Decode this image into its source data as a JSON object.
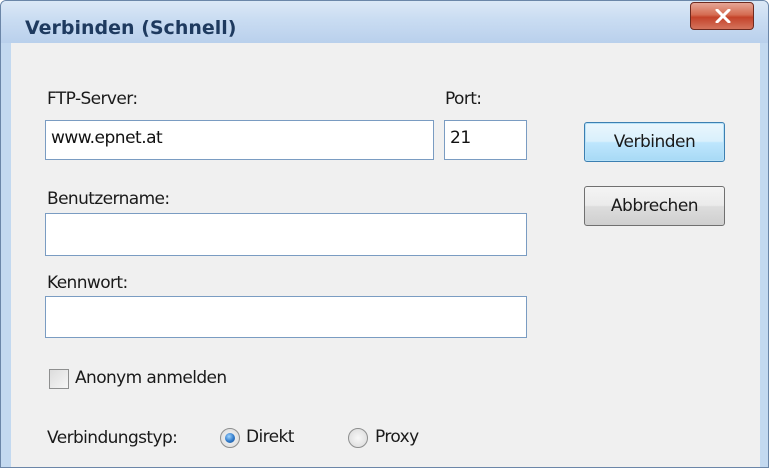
{
  "window": {
    "title": "Verbinden (Schnell)",
    "close_icon": "close-icon"
  },
  "form": {
    "server_label": "FTP-Server:",
    "server_value": "www.epnet.at",
    "port_label": "Port:",
    "port_value": "21",
    "username_label": "Benutzername:",
    "username_value": "",
    "password_label": "Kennwort:",
    "password_value": "",
    "anonymous_label": "Anonym anmelden",
    "anonymous_checked": false,
    "connection_type_label": "Verbindungstyp:",
    "connection_options": [
      {
        "label": "Direkt",
        "selected": true
      },
      {
        "label": "Proxy",
        "selected": false
      }
    ]
  },
  "buttons": {
    "connect_label": "Verbinden",
    "cancel_label": "Abbrechen"
  },
  "colors": {
    "title_text": "#1e3a5f",
    "close_button": "#c4432a",
    "default_button_border": "#3c7fb1",
    "input_border": "#7a9cc2"
  }
}
